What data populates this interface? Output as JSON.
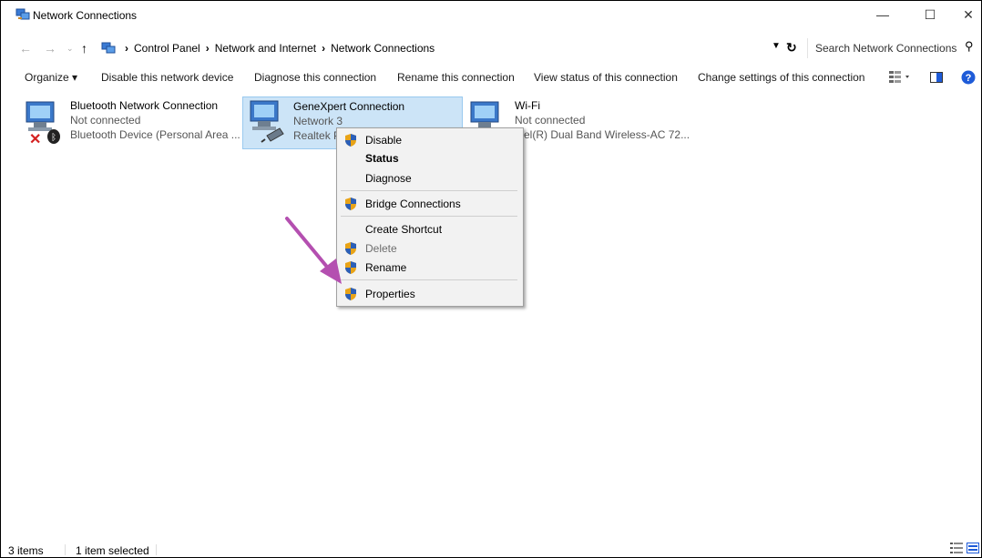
{
  "window": {
    "title": "Network Connections",
    "minimize": "—",
    "maximize": "☐",
    "close": "✕"
  },
  "address": {
    "crumbs": [
      "Control Panel",
      "Network and Internet",
      "Network Connections"
    ],
    "search_placeholder": "Search Network Connections"
  },
  "commands": {
    "organize": "Organize ▾",
    "disable": "Disable this network device",
    "diagnose": "Diagnose this connection",
    "rename": "Rename this connection",
    "view_status": "View status of this connection",
    "change_settings": "Change settings of this connection"
  },
  "items": [
    {
      "name": "Bluetooth Network Connection",
      "status": "Not connected",
      "device": "Bluetooth Device (Personal Area ..."
    },
    {
      "name": "GeneXpert Connection",
      "status": "Network  3",
      "device": "Realtek P"
    },
    {
      "name": "Wi-Fi",
      "status": "Not connected",
      "device": "ntel(R) Dual Band Wireless-AC 72..."
    }
  ],
  "context_menu": {
    "disable": "Disable",
    "status": "Status",
    "diagnose": "Diagnose",
    "bridge": "Bridge Connections",
    "shortcut": "Create Shortcut",
    "delete": "Delete",
    "rename": "Rename",
    "properties": "Properties"
  },
  "statusbar": {
    "count": "3 items",
    "selected": "1 item selected"
  },
  "colors": {
    "selection": "#cce4f7",
    "arrow": "#b44fb0",
    "help": "#1e5bd8"
  }
}
